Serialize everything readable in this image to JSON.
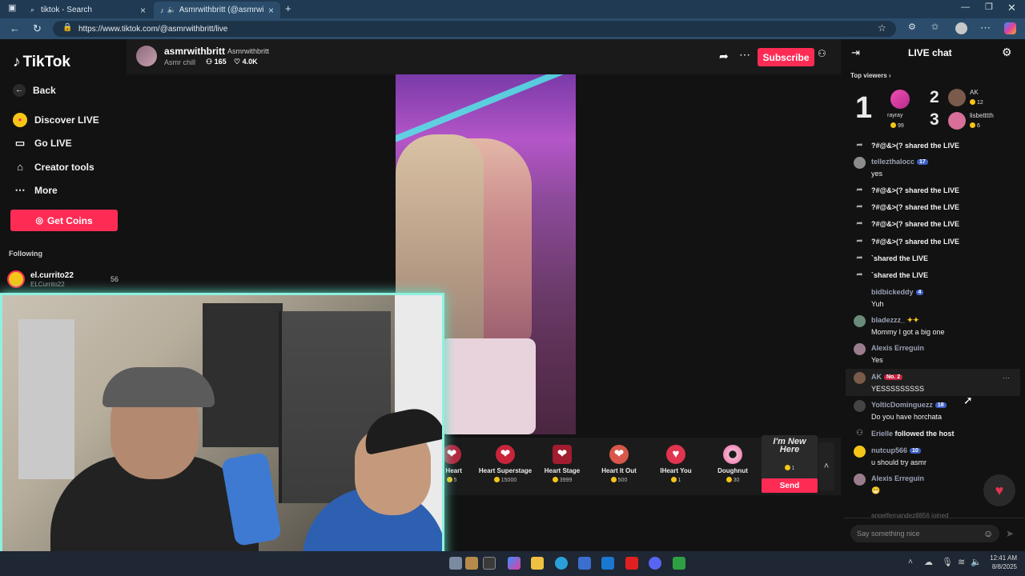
{
  "browser": {
    "tabs": [
      {
        "title": "tiktok - Search"
      },
      {
        "title": "Asmrwithbritt (@asmrwithbr"
      }
    ],
    "url": "https://www.tiktok.com/@asmrwithbritt/live",
    "new_tab": "+"
  },
  "sidebar": {
    "logo": "TikTok",
    "items": [
      {
        "label": "Back",
        "icon": "arrow-left-icon"
      },
      {
        "label": "Discover LIVE",
        "icon": "live-icon"
      },
      {
        "label": "Go LIVE",
        "icon": "video-camera-icon"
      },
      {
        "label": "Creator tools",
        "icon": "house-icon"
      },
      {
        "label": "More",
        "icon": "ellipsis-icon"
      }
    ],
    "get_coins": "Get Coins",
    "following_heading": "Following",
    "following": [
      {
        "name": "el.currito22",
        "handle": "ELCurrito22",
        "count": "56"
      }
    ]
  },
  "stream": {
    "username": "asmrwithbritt",
    "display_name": "Asmrwithbritt",
    "category": "Asmr chill",
    "viewers": "165",
    "likes": "4.0K",
    "subscribe": "Subscribe"
  },
  "gifts": [
    {
      "name": "r Heart",
      "price": "5"
    },
    {
      "name": "Heart Superstage",
      "price": "15000"
    },
    {
      "name": "Heart Stage",
      "price": "3999"
    },
    {
      "name": "Heart It Out",
      "price": "500"
    },
    {
      "name": "IHeart You",
      "price": "1"
    },
    {
      "name": "Doughnut",
      "price": "30"
    }
  ],
  "new_gift": {
    "label": "I'm New Here",
    "price": "1",
    "send": "Send"
  },
  "chat": {
    "title": "LIVE chat",
    "top_viewers_label": "Top viewers",
    "top": [
      {
        "rank": "1",
        "name": "rayray",
        "coins": "99"
      },
      {
        "rank": "2",
        "name": "AK",
        "coins": "12"
      },
      {
        "rank": "3",
        "name": "lisbetttth",
        "coins": "6"
      }
    ],
    "messages": [
      {
        "type": "line",
        "text": "?#@&>(? shared the LIVE"
      },
      {
        "type": "msg",
        "user": "tellezthalocc",
        "badge": "17",
        "text": "yes"
      },
      {
        "type": "line",
        "text": "?#@&>(? shared the LIVE"
      },
      {
        "type": "line",
        "text": "?#@&>(? shared the LIVE"
      },
      {
        "type": "line",
        "text": "?#@&>(? shared the LIVE"
      },
      {
        "type": "line",
        "text": "?#@&>(? shared the LIVE"
      },
      {
        "type": "line",
        "text": "`shared the LIVE"
      },
      {
        "type": "line",
        "text": "`shared the LIVE"
      },
      {
        "type": "msg",
        "user": "bidbickeddy",
        "badge": "4",
        "text": "Yuh"
      },
      {
        "type": "msg",
        "user": "bladezzz_",
        "badge": "",
        "text": "Mommy I got a big one"
      },
      {
        "type": "msg",
        "user": "Alexis Erreguin",
        "badge": "",
        "text": "Yes"
      },
      {
        "type": "msg",
        "user": "AK",
        "badge": "No. 2",
        "text": "YESSSSSSSSS"
      },
      {
        "type": "msg",
        "user": "YolticDominguezz",
        "badge": "18",
        "text": "Do you have horchata"
      },
      {
        "type": "follow",
        "user": "Erielle",
        "text": "followed the host"
      },
      {
        "type": "msg",
        "user": "nutcup566",
        "badge": "10",
        "text": "u should try asmr"
      },
      {
        "type": "msg",
        "user": "Alexis Erreguin",
        "badge": "",
        "text": "😁"
      }
    ],
    "partial": "angelfernandez8856 joined",
    "input_placeholder": "Say something nice"
  },
  "taskbar": {
    "time": "12:41 AM",
    "date": "8/8/2025"
  },
  "colors": {
    "accent": "#fe2c55",
    "coin": "#f5c518",
    "cam_border": "#8ff0df"
  }
}
